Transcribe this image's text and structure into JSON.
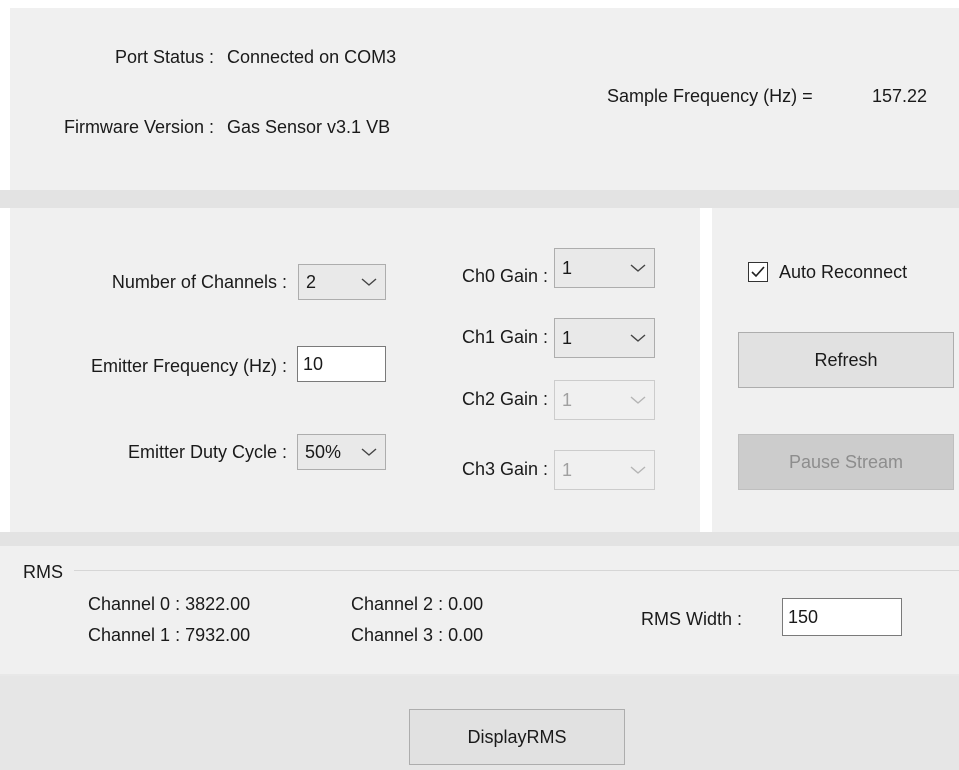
{
  "status": {
    "port_status_label": "Port Status :",
    "port_status_value": "Connected on COM3",
    "firmware_label": "Firmware Version :",
    "firmware_value": "Gas Sensor v3.1 VB",
    "sample_freq_label": "Sample Frequency (Hz) =",
    "sample_freq_value": "157.22"
  },
  "settings": {
    "num_channels_label": "Number of Channels :",
    "num_channels_value": "2",
    "emitter_freq_label": "Emitter Frequency (Hz) :",
    "emitter_freq_value": "10",
    "duty_cycle_label": "Emitter Duty Cycle :",
    "duty_cycle_value": "50%",
    "gains": [
      {
        "label": "Ch0 Gain :",
        "value": "1",
        "enabled": true
      },
      {
        "label": "Ch1 Gain :",
        "value": "1",
        "enabled": true
      },
      {
        "label": "Ch2 Gain :",
        "value": "1",
        "enabled": false
      },
      {
        "label": "Ch3 Gain :",
        "value": "1",
        "enabled": false
      }
    ]
  },
  "controls": {
    "auto_reconnect_label": "Auto Reconnect",
    "auto_reconnect_checked": true,
    "refresh_label": "Refresh",
    "pause_label": "Pause Stream",
    "pause_enabled": false
  },
  "rms": {
    "group_label": "RMS",
    "channels": [
      {
        "text": "Channel 0 : 3822.00"
      },
      {
        "text": "Channel 1 : 7932.00"
      },
      {
        "text": "Channel 2 : 0.00"
      },
      {
        "text": "Channel 3 : 0.00"
      }
    ],
    "width_label": "RMS Width :",
    "width_value": "150"
  },
  "footer": {
    "display_rms_label": "DisplayRMS"
  },
  "icons": {
    "dropdown": "chevron-down-icon",
    "check": "checkmark-icon"
  },
  "colors": {
    "panel_bg": "#f0f0f0",
    "divider": "#e3e3e3",
    "button_bg": "#e1e1e1",
    "disabled_text": "#a0a0a0"
  }
}
